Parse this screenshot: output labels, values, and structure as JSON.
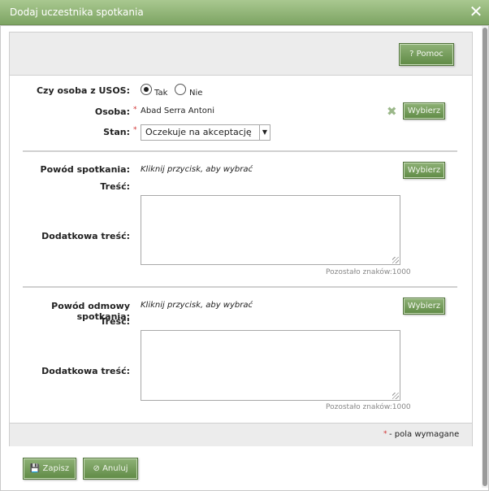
{
  "window": {
    "title": "Dodaj uczestnika spotkania"
  },
  "toolbar": {
    "help_label": "? Pomoc"
  },
  "form": {
    "usos_label": "Czy osoba z USOS:",
    "usos_options": [
      "Tak",
      "Nie"
    ],
    "person_label": "Osoba:",
    "person_value": "Abad Serra Antoni",
    "choose_label": "Wybierz",
    "state_label": "Stan:",
    "state_value": "Oczekuje na akceptację",
    "reason_label": "Powód spotkania:",
    "reason_hint": "Kliknij przycisk, aby wybrać",
    "content_label": "Treść:",
    "extra_label": "Dodatkowa treść:",
    "remaining": "Pozostało znaków:1000",
    "refusal_label": "Powód odmowy spotkania:",
    "refusal_hint": "Kliknij przycisk, aby wybrać",
    "required_mark": "*",
    "required_note": "- pola wymagane"
  },
  "footer": {
    "save_label": "Zapisz",
    "cancel_label": "Anuluj"
  },
  "colors": {
    "title_bar": "#7da463",
    "button": "#6b9450",
    "required": "#d03030"
  }
}
